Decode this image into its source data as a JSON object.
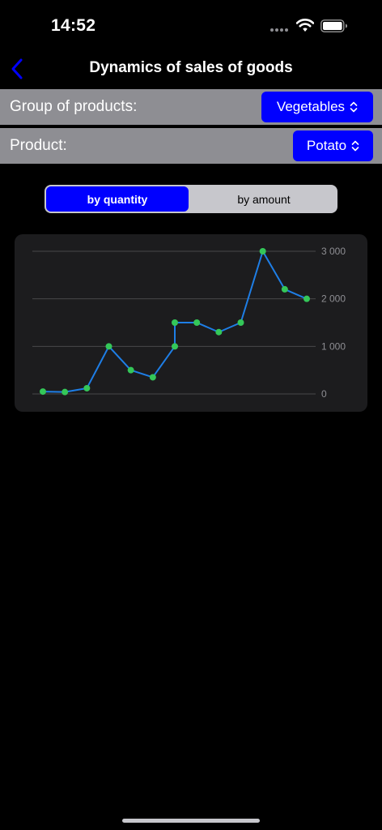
{
  "status": {
    "time": "14:52"
  },
  "nav": {
    "title": "Dynamics of sales of goods"
  },
  "filters": {
    "group_label": "Group of products:",
    "group_value": "Vegetables",
    "product_label": "Product:",
    "product_value": "Potato"
  },
  "segments": {
    "quantity_label": "by quantity",
    "amount_label": "by amount",
    "selected": "by quantity"
  },
  "colors": {
    "accent": "#0000ff",
    "line": "#1e7ee6",
    "point": "#34c759",
    "card": "#1c1c1e",
    "filter_row": "#8e8e93"
  },
  "chart_data": {
    "type": "line",
    "x": [
      1,
      2,
      3,
      4,
      5,
      6,
      7,
      7,
      8,
      9,
      10,
      11,
      12,
      13
    ],
    "y": [
      50,
      40,
      120,
      1000,
      500,
      350,
      1000,
      1500,
      1500,
      1300,
      1500,
      3000,
      2200,
      2000
    ],
    "ylim": [
      0,
      3000
    ],
    "yticks": [
      0,
      1000,
      2000,
      3000
    ],
    "ytick_labels": [
      "0",
      "1 000",
      "2 000",
      "3 000"
    ],
    "grid": true,
    "title": "",
    "xlabel": "",
    "ylabel": ""
  }
}
